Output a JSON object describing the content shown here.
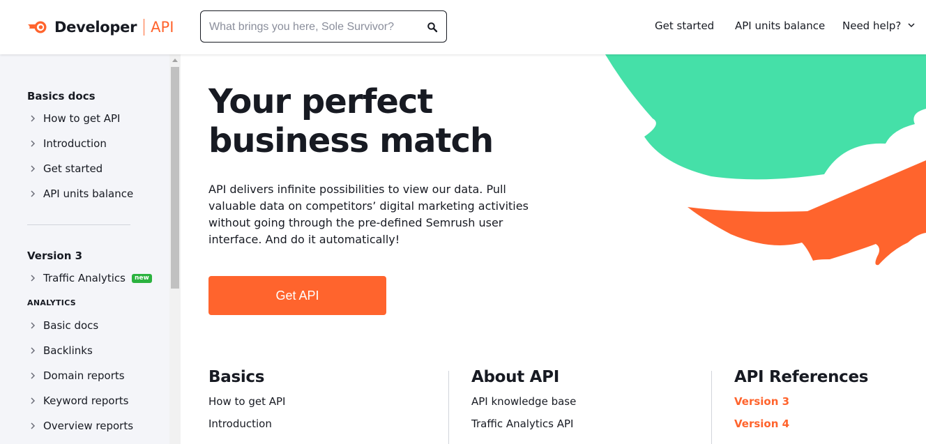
{
  "header": {
    "logo_text": "Developer",
    "logo_sub": "API",
    "search_placeholder": "What brings you here, Sole Survivor?",
    "nav": [
      {
        "label": "Get started"
      },
      {
        "label": "API units balance"
      },
      {
        "label": "Need help?"
      }
    ]
  },
  "sidebar": {
    "basics_heading": "Basics docs",
    "basics_items": [
      "How to get API",
      "Introduction",
      "Get started",
      "API units balance"
    ],
    "version_heading": "Version 3",
    "traffic_item": "Traffic Analytics",
    "badge": "new",
    "analytics_caption": "ANALYTICS",
    "analytics_items": [
      "Basic docs",
      "Backlinks",
      "Domain reports",
      "Keyword reports",
      "Overview reports"
    ]
  },
  "hero": {
    "title": "Your perfect business match",
    "description": "API delivers infinite possibilities to view our data. Pull valuable data on competitors’ digital marketing activities without going through the pre-defined Semrush user interface. And do it automatically!",
    "cta": "Get API"
  },
  "columns": [
    {
      "title": "Basics",
      "links": [
        "How to get API",
        "Introduction"
      ]
    },
    {
      "title": "About API",
      "links": [
        "API knowledge base",
        "Traffic Analytics API"
      ]
    },
    {
      "title": "API References",
      "links": [
        "Version 3",
        "Version 4"
      ]
    }
  ],
  "colors": {
    "accent": "#ff642d",
    "green": "#45e0a8",
    "badge": "#2bb23f",
    "sidebar_bg": "#f4f5f9"
  },
  "icons": [
    "semrush-logo-icon",
    "search-icon",
    "chevron-down-icon",
    "chevron-right-icon"
  ]
}
